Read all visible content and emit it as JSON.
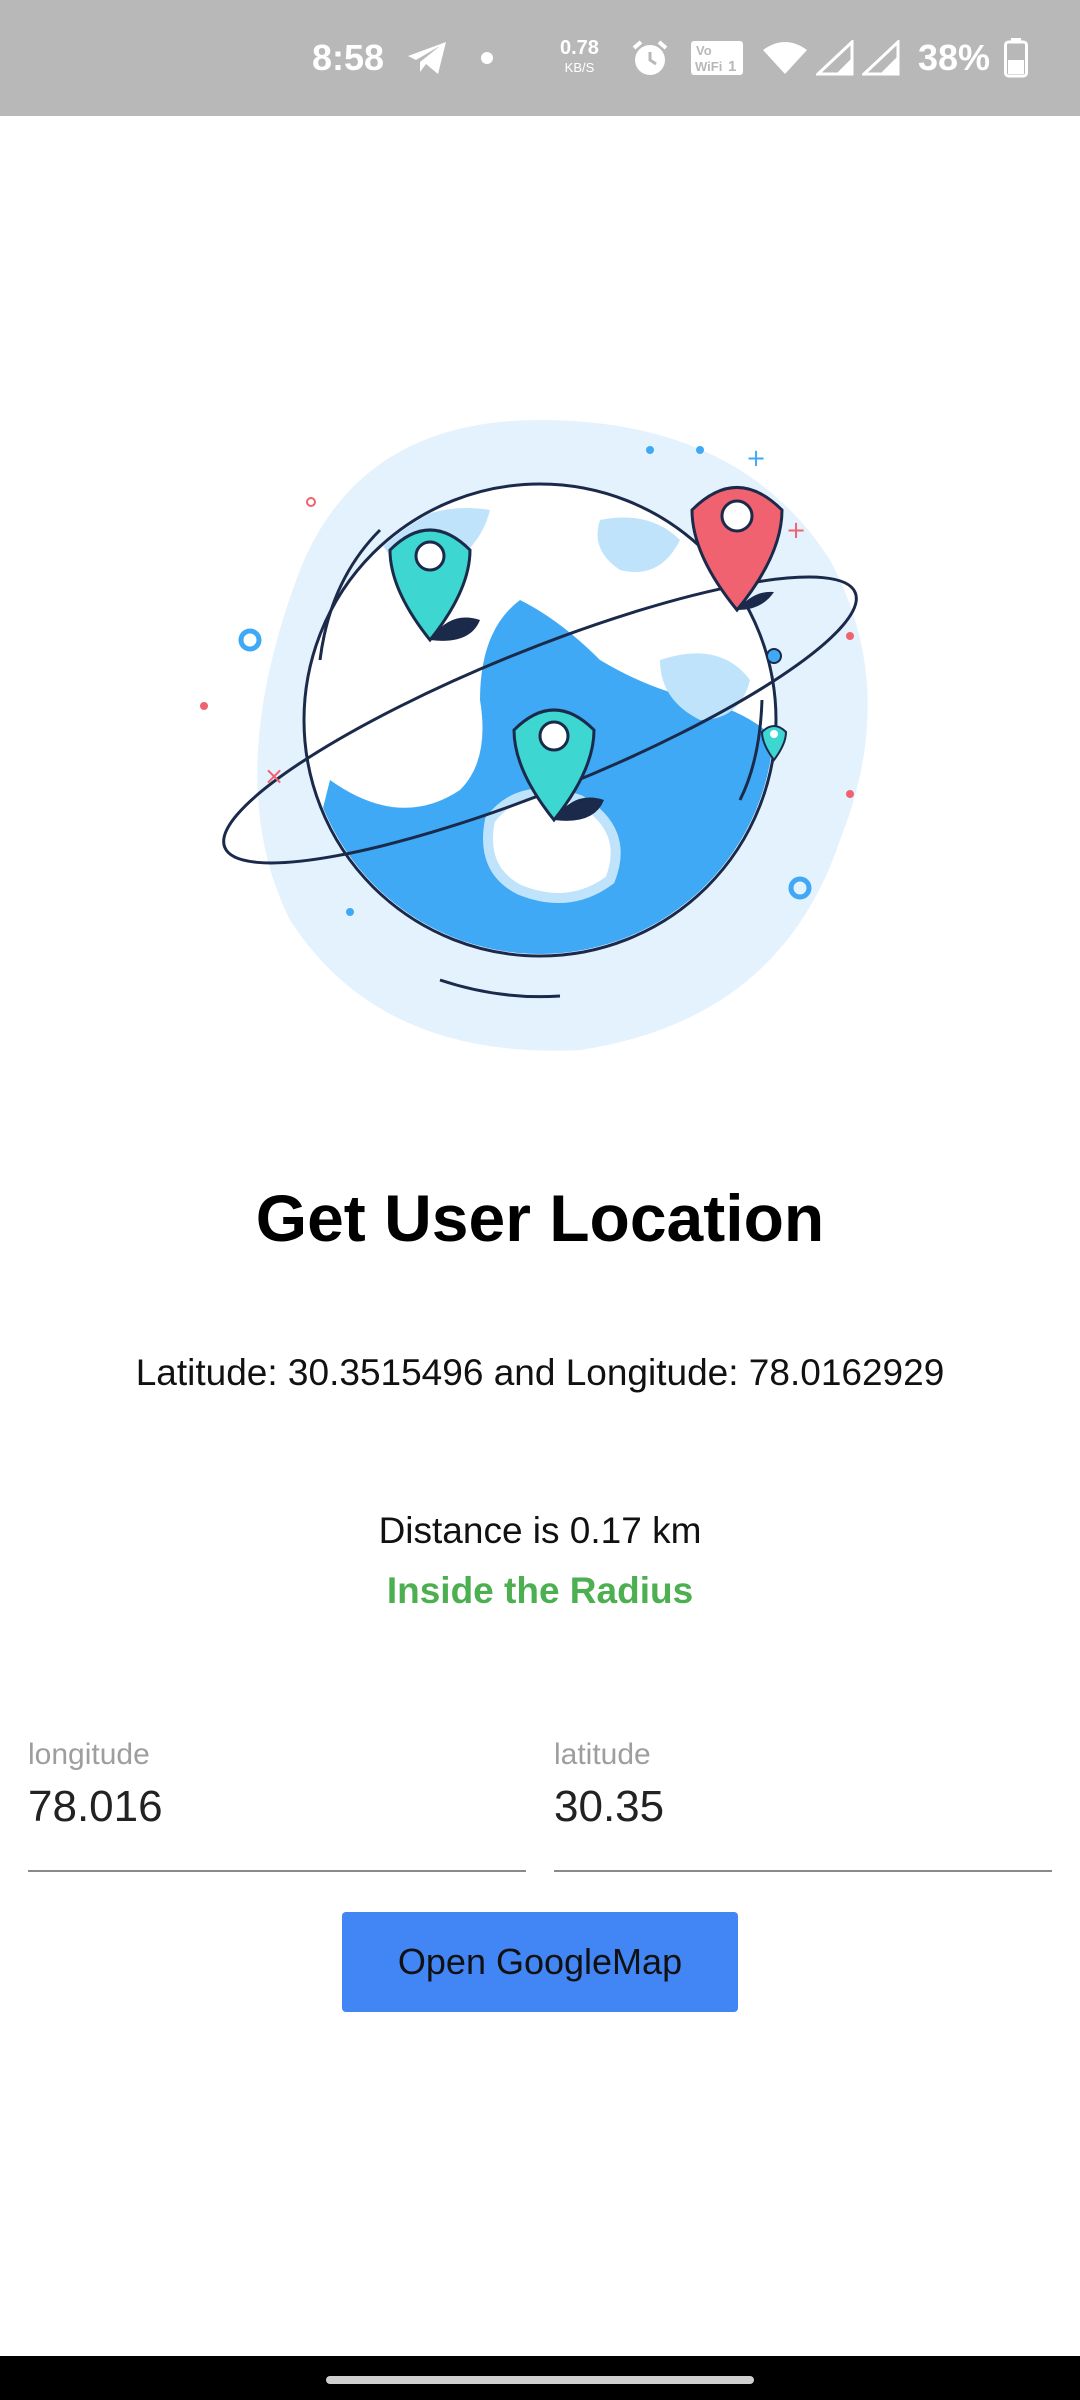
{
  "status_bar": {
    "time": "8:58",
    "net_speed_value": "0.78",
    "net_speed_unit": "KB/S",
    "battery_percent": "38%",
    "icons": [
      "telegram-icon",
      "dot-icon",
      "alarm-icon",
      "vowifi-icon",
      "wifi-icon",
      "signal-icon",
      "signal-icon",
      "battery-icon"
    ]
  },
  "hero": {
    "illustration": "globe-with-location-pins",
    "colors": {
      "globe_blue": "#3fa9f5",
      "pale_blue": "#e3f2fd",
      "pin_teal": "#3dd6d0",
      "pin_red": "#f06270",
      "outline": "#1b2a4a"
    }
  },
  "main": {
    "title": "Get User Location",
    "coordinates_text": "Latitude: 30.3515496 and Longitude: 78.0162929",
    "distance_text": "Distance is 0.17 km",
    "radius_status": "Inside the Radius",
    "radius_status_color": "#4caf50"
  },
  "form": {
    "longitude_label": "longitude",
    "longitude_value": "78.016",
    "latitude_label": "latitude",
    "latitude_value": "30.35",
    "button_label": "Open GoogleMap",
    "button_color": "#4285f4"
  }
}
